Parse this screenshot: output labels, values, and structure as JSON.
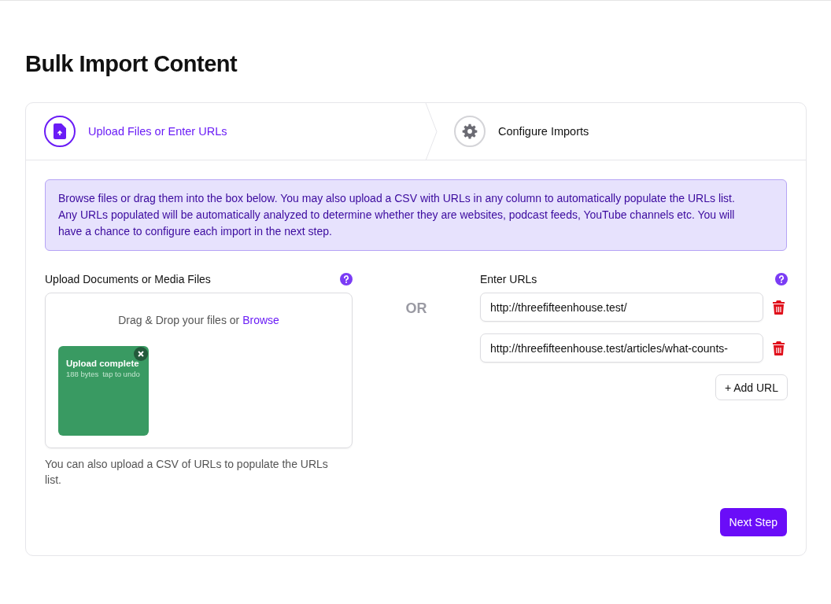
{
  "page_title": "Bulk Import Content",
  "steps": [
    {
      "label": "Upload Files or Enter URLs",
      "kind": "upload",
      "selected": true
    },
    {
      "label": "Configure Imports",
      "kind": "configure",
      "selected": false
    }
  ],
  "info": "Browse files or drag them into the box below. You may also upload a CSV with URLs in any column to automatically populate the URLs list. Any URLs populated will be automatically analyzed to determine whether they are websites, podcast feeds, YouTube channels etc. You will have a chance to configure each import in the next step.",
  "upload": {
    "label": "Upload Documents or Media Files",
    "drop_text": "Drag & Drop your files or",
    "browse": "Browse",
    "files": [
      {
        "status": "Upload complete",
        "size": "188 bytes",
        "hint": "tap to undo"
      }
    ],
    "note": "You can also upload a CSV of URLs to populate the URLs list."
  },
  "separator": "OR",
  "urls": {
    "label": "Enter URLs",
    "items": [
      "http://threefifteenhouse.test/",
      "http://threefifteenhouse.test/articles/what-counts-"
    ],
    "add_button": "+ Add URL"
  },
  "next_button": "Next Step"
}
